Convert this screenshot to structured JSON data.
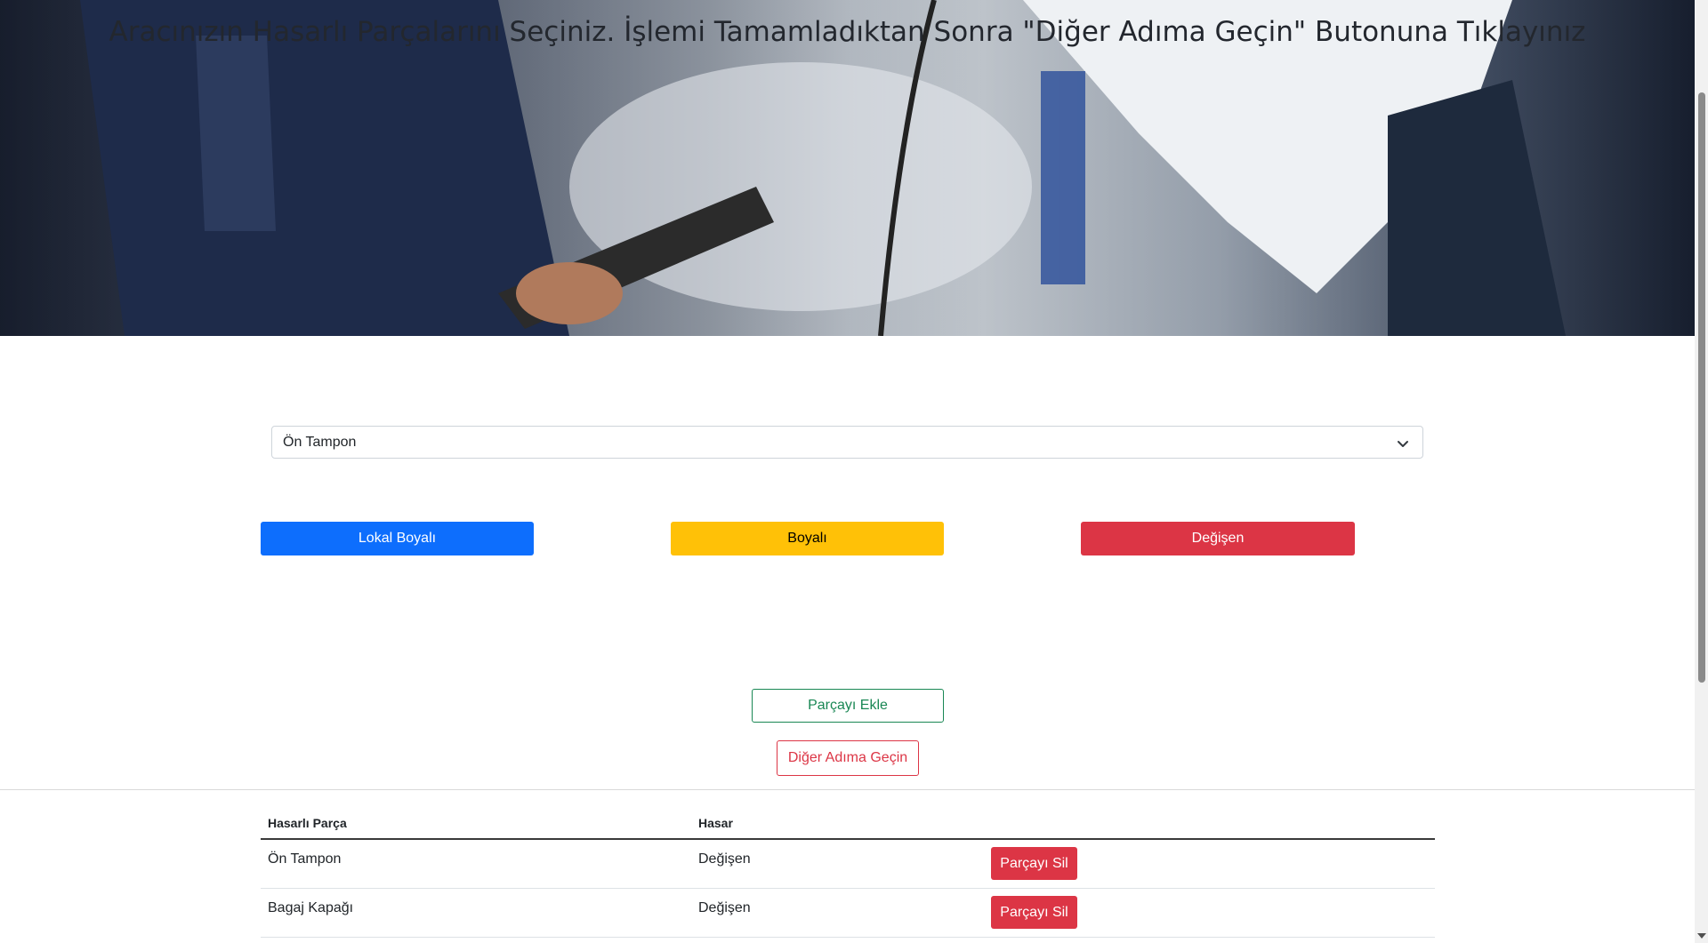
{
  "hero": {
    "title": "Aracınızın Hasarlı Parçalarını Seçiniz. İşlemi Tamamladıktan Sonra \"Diğer Adıma Geçin\" Butonuna Tıklayınız"
  },
  "part_select": {
    "value": "Ön Tampon"
  },
  "damage_buttons": {
    "local_painted": "Lokal Boyalı",
    "painted": "Boyalı",
    "replaced": "Değişen"
  },
  "actions": {
    "add_part": "Parçayı Ekle",
    "next_step": "Diğer Adıma Geçin"
  },
  "table": {
    "headers": [
      "Hasarlı Parça",
      "Hasar"
    ],
    "rows": [
      {
        "part": "Ön Tampon",
        "damage": "Değişen",
        "delete_label": "Parçayı Sil"
      },
      {
        "part": "Bagaj Kapağı",
        "damage": "Değişen",
        "delete_label": "Parçayı Sil"
      }
    ]
  },
  "colors": {
    "primary": "#0d6efd",
    "warning": "#ffc107",
    "danger": "#dc3545",
    "success": "#198754"
  }
}
